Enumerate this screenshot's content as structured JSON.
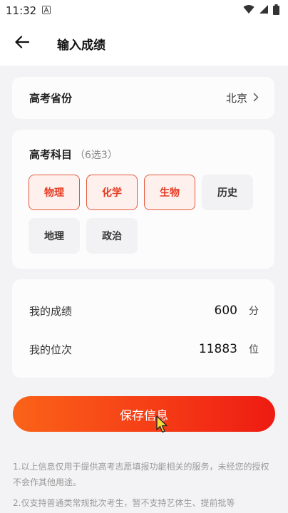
{
  "status_bar": {
    "time": "11:32",
    "icons": [
      "notification-a-icon",
      "wifi-icon",
      "cellular-icon",
      "battery-icon"
    ]
  },
  "header": {
    "back_icon": "arrow-left-icon",
    "title": "输入成绩"
  },
  "province": {
    "label": "高考省份",
    "value": "北京",
    "chevron_icon": "chevron-right-icon"
  },
  "subjects": {
    "title": "高考科目",
    "hint": "（6选3）",
    "items": [
      {
        "label": "物理",
        "selected": true
      },
      {
        "label": "化学",
        "selected": true
      },
      {
        "label": "生物",
        "selected": true
      },
      {
        "label": "历史",
        "selected": false
      },
      {
        "label": "地理",
        "selected": false
      },
      {
        "label": "政治",
        "selected": false
      }
    ]
  },
  "scores": {
    "score_label": "我的成绩",
    "score_value": "600",
    "score_unit": "分",
    "rank_label": "我的位次",
    "rank_value": "11883",
    "rank_unit": "位"
  },
  "save_button": {
    "label": "保存信息"
  },
  "notes": [
    "1.以上信息仅用于提供高考志愿填报功能相关的服务，未经您的授权不会作其他用途。",
    "2.仅支持普通类常规批次考生，暂不支持艺体生、提前批等"
  ],
  "colors": {
    "accent": "#e63a21",
    "button_gradient_start": "#fb6319",
    "button_gradient_end": "#ee1b12",
    "background": "#f3f3f5"
  }
}
